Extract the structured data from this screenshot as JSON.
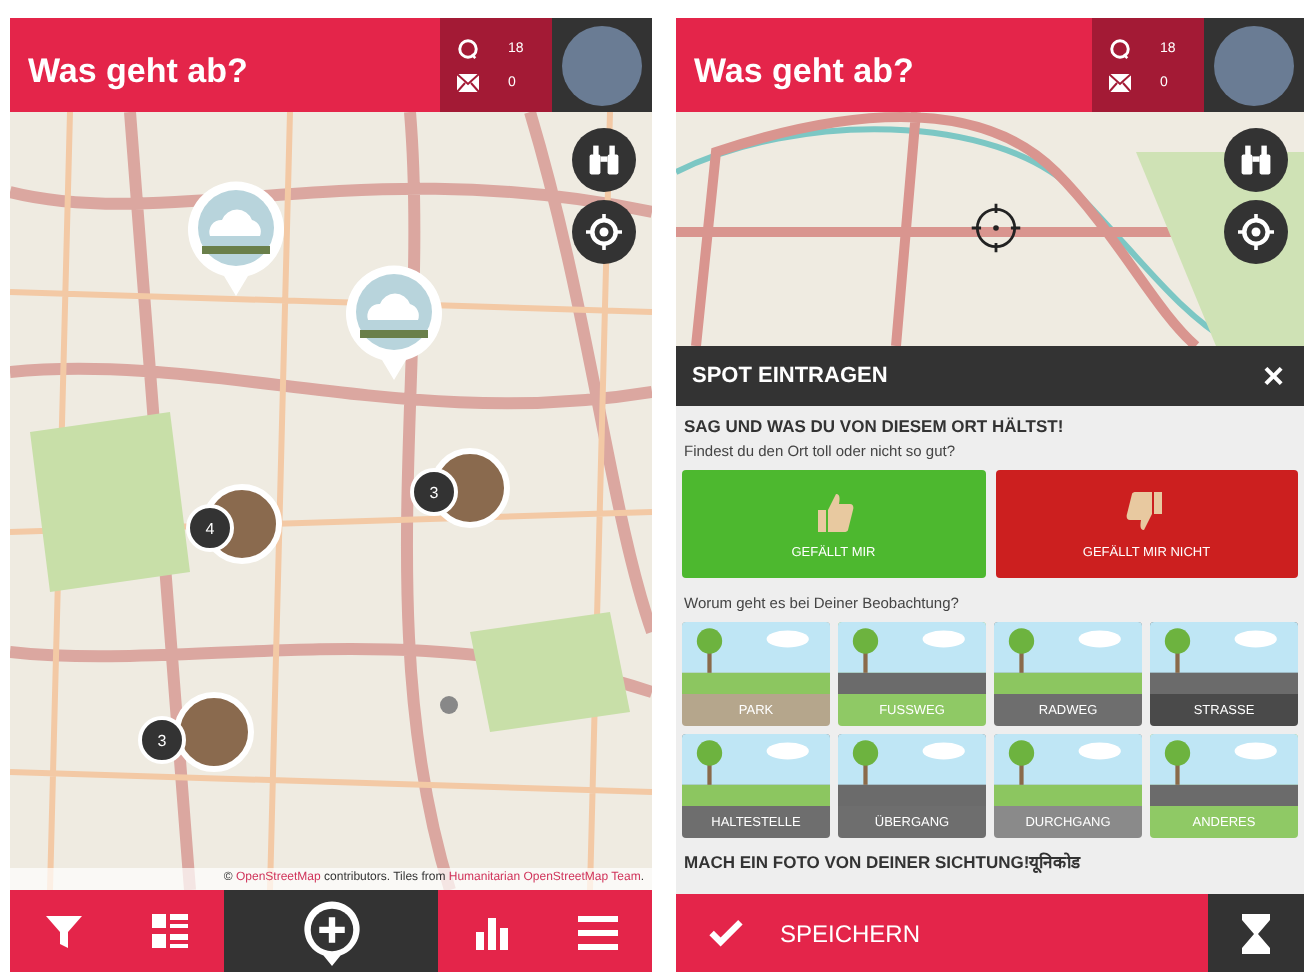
{
  "map_screen": {
    "header": {
      "title": "Was geht ab?",
      "comment_count": "18",
      "message_count": "0"
    },
    "photo_markers": [
      {
        "kind": "cloud"
      },
      {
        "kind": "cloud"
      }
    ],
    "clusters": [
      {
        "count": "4"
      },
      {
        "count": "3"
      },
      {
        "count": "3"
      }
    ],
    "attribution": [
      {
        "kind": "text",
        "text": "©"
      },
      {
        "kind": "link",
        "text": "OpenStreetMap"
      },
      {
        "kind": "text",
        "text": "contributors. Tiles from"
      },
      {
        "kind": "link",
        "text": "Humanitarian OpenStreetMap Team"
      },
      {
        "kind": "end",
        "text": "."
      }
    ]
  },
  "spot_screen": {
    "header": {
      "title": "Was geht ab?",
      "comment_count": "18",
      "message_count": "0"
    },
    "panel_title": "SPOT EINTRAGEN",
    "close": "×",
    "heading": "SAG UND WAS DU VON DIESEM ORT HÄLTST!",
    "subtitle": "Findest du den Ort toll oder nicht so gut?",
    "ratings": [
      {
        "kind": "like",
        "label": "GEFÄLLT MIR",
        "color": "#4db82f"
      },
      {
        "kind": "dislike",
        "label": "GEFÄLLT MIR NICHT",
        "color": "#cc1f1f"
      }
    ],
    "question": "Worum geht es bei Deiner Beobachtung?",
    "categories": [
      {
        "label": "PARK",
        "color": "#b5a68c"
      },
      {
        "label": "FUSSWEG",
        "color": "#8fc965"
      },
      {
        "label": "RADWEG",
        "color": "#6e6e6e"
      },
      {
        "label": "STRASSE",
        "color": "#4a4a4a"
      },
      {
        "label": "HALTESTELLE",
        "color": "#6e6e6e"
      },
      {
        "label": "ÜBERGANG",
        "color": "#6e6e6e"
      },
      {
        "label": "DURCHGANG",
        "color": "#8a8a8a"
      },
      {
        "label": "ANDERES",
        "color": "#8fc965"
      }
    ],
    "photo_heading": "MACH EIN FOTO VON DEINER SICHTUNG!यूनिकोड",
    "save_label": "SPEICHERN"
  }
}
